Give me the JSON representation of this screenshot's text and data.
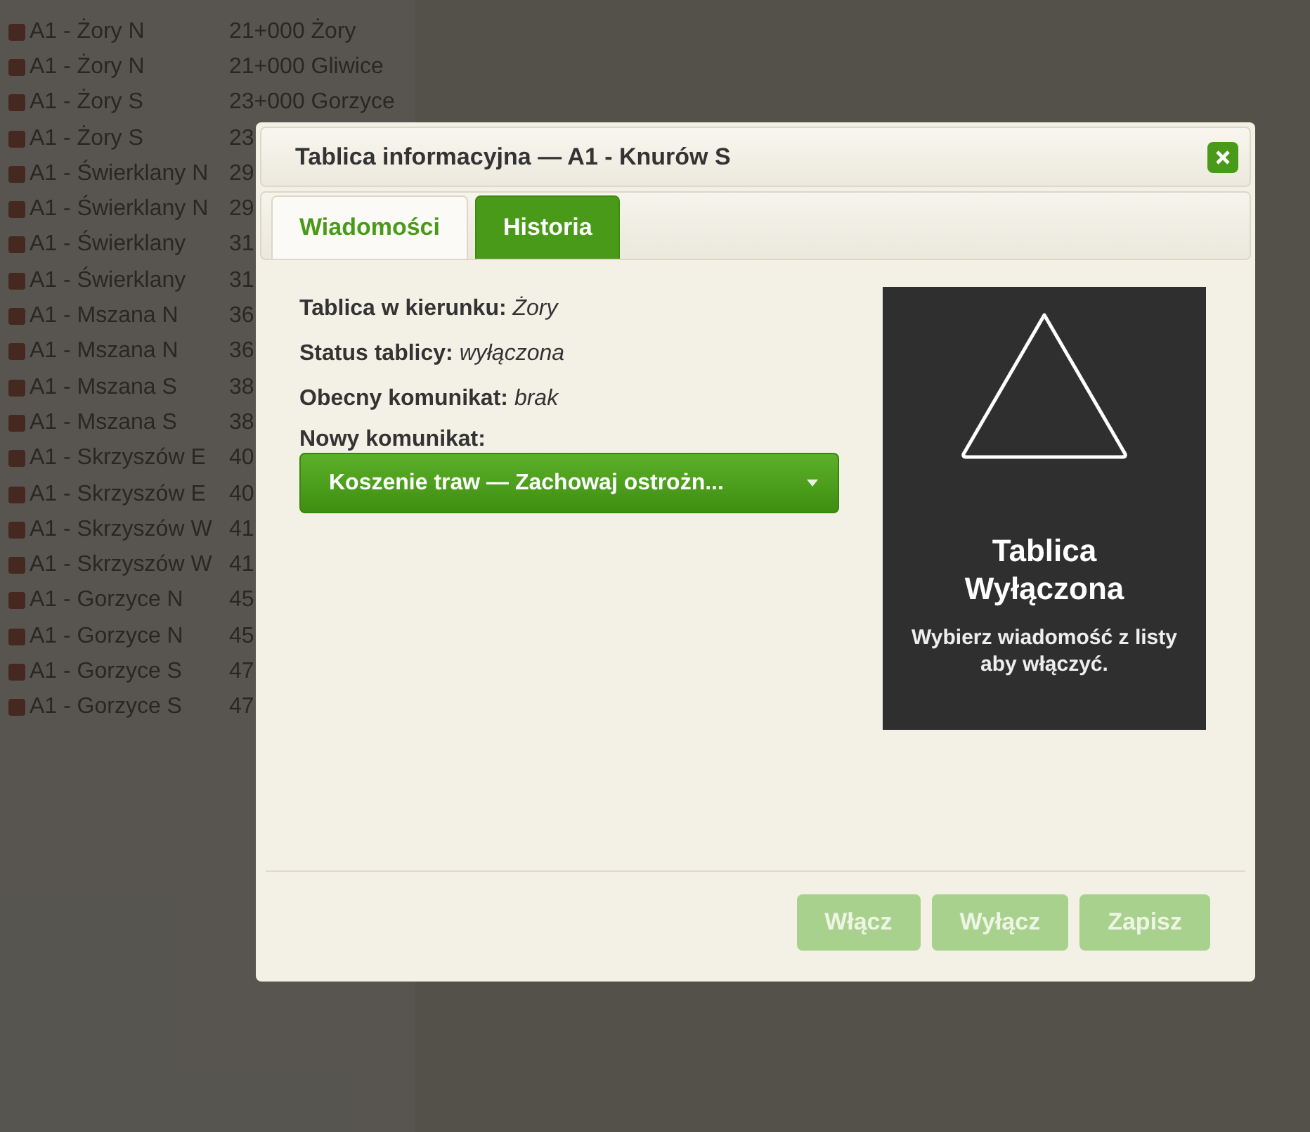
{
  "background_list": {
    "rows": [
      {
        "name": "A1 - Żory N",
        "location": "21+000 Żory"
      },
      {
        "name": "A1 - Żory N",
        "location": "21+000 Gliwice"
      },
      {
        "name": "A1 - Żory S",
        "location": "23+000 Gorzyce"
      },
      {
        "name": "A1 - Żory S",
        "location": "23"
      },
      {
        "name": "A1 - Świerklany N",
        "location": "29"
      },
      {
        "name": "A1 - Świerklany N",
        "location": "29"
      },
      {
        "name": "A1 - Świerklany",
        "location": "31"
      },
      {
        "name": "A1 - Świerklany",
        "location": "31"
      },
      {
        "name": "A1 - Mszana N",
        "location": "36"
      },
      {
        "name": "A1 - Mszana N",
        "location": "36"
      },
      {
        "name": "A1 - Mszana S",
        "location": "38"
      },
      {
        "name": "A1 - Mszana S",
        "location": "38"
      },
      {
        "name": "A1 - Skrzyszów E",
        "location": "40"
      },
      {
        "name": "A1 - Skrzyszów E",
        "location": "40"
      },
      {
        "name": "A1 - Skrzyszów W",
        "location": "41"
      },
      {
        "name": "A1 - Skrzyszów W",
        "location": "41"
      },
      {
        "name": "A1 - Gorzyce N",
        "location": "45"
      },
      {
        "name": "A1 - Gorzyce N",
        "location": "45"
      },
      {
        "name": "A1 - Gorzyce S",
        "location": "47"
      },
      {
        "name": "A1 - Gorzyce S",
        "location": "47"
      }
    ]
  },
  "dialog": {
    "title": "Tablica informacyjna — A1 - Knurów S",
    "tabs": [
      {
        "label": "Wiadomości",
        "selected": true
      },
      {
        "label": "Historia",
        "selected": false
      }
    ],
    "fields": [
      {
        "label": "Tablica w kierunku:",
        "value": "Żory"
      },
      {
        "label": "Status tablicy:",
        "value": "wyłączona"
      },
      {
        "label": "Obecny komunikat:",
        "value": "brak"
      }
    ],
    "new_message": {
      "label": "Nowy komunikat:",
      "value": "Koszenie traw — Zachowaj ostrożn..."
    },
    "sign": {
      "title": "Tablica Wyłączona",
      "hint": "Wybierz wiadomość z listy aby włączyć."
    },
    "buttons": [
      {
        "label": "Włącz",
        "disabled": true
      },
      {
        "label": "Wyłącz",
        "disabled": true
      },
      {
        "label": "Zapisz",
        "disabled": true
      }
    ]
  }
}
